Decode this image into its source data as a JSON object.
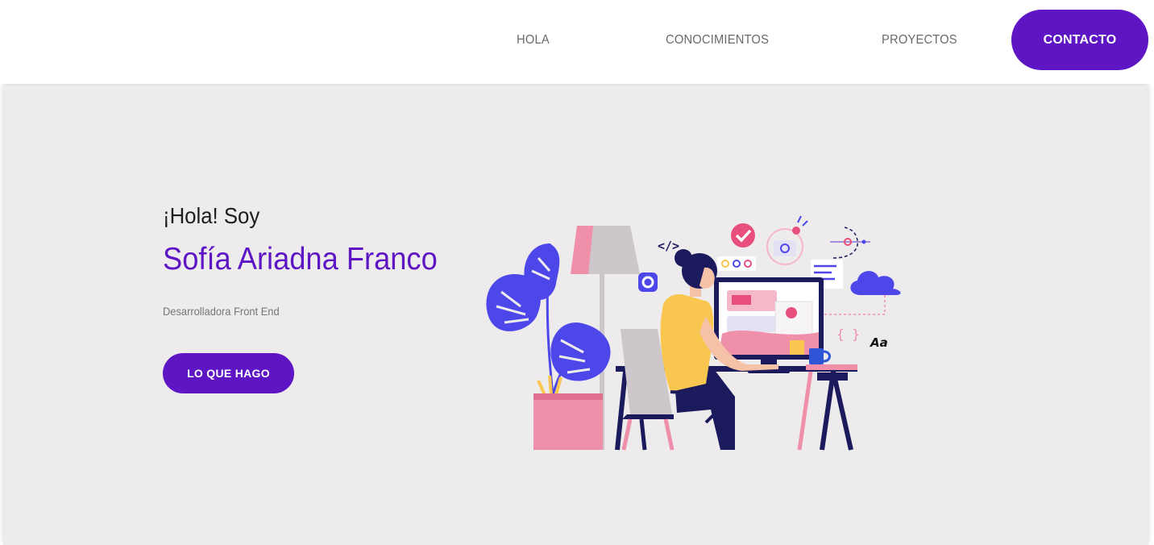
{
  "nav": {
    "links": [
      "HOLA",
      "CONOCIMIENTOS",
      "PROYECTOS"
    ],
    "cta_label": "CONTACTO"
  },
  "hero": {
    "greeting": "¡Hola! Soy",
    "name": "Sofía Ariadna Franco",
    "role": "Desarrolladora Front End",
    "button_label": "LO QUE HAGO"
  },
  "illustration": {
    "code_tag": "</>",
    "braces": "{ }",
    "typography": "Aa",
    "icons": [
      "plant-icon",
      "lamp-icon",
      "gear-icon",
      "check-icon",
      "target-icon",
      "cloud-icon",
      "monitor-icon",
      "coffee-cup-icon",
      "sticky-note-icon"
    ]
  },
  "colors": {
    "accent": "#5e15c4",
    "hero_background": "#edebec",
    "plant_blue": "#4d47ea",
    "pink": "#f08fa9",
    "shirt_yellow": "#f9c74f",
    "navy": "#1b1a5c"
  }
}
